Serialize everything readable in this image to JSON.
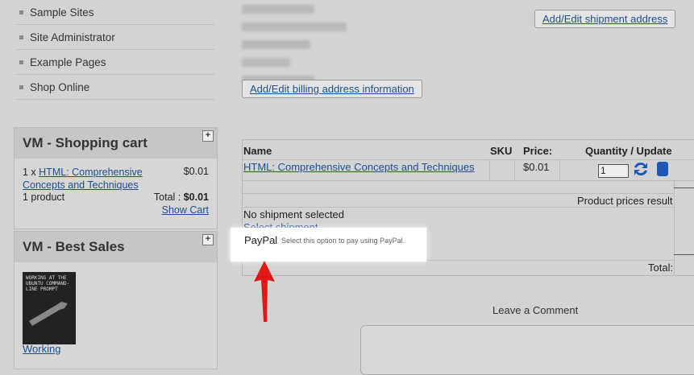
{
  "menu": {
    "items": [
      {
        "label": "Sample Sites"
      },
      {
        "label": "Site Administrator"
      },
      {
        "label": "Example Pages"
      },
      {
        "label": "Shop Online"
      }
    ]
  },
  "cart": {
    "title": "VM - Shopping cart",
    "qty_prefix": "1 x ",
    "item_link": "HTML: Comprehensive Concepts and Techniques",
    "item_price": "$0.01",
    "count": "1 product",
    "total_label": "Total : ",
    "total_value": "$0.01",
    "show_cart": "Show Cart"
  },
  "best_sales": {
    "title": "VM - Best Sales",
    "book_cover_text": "Working at the Ubuntu Command-Line Prompt",
    "book_link": "Working"
  },
  "buttons": {
    "shipment_address": "Add/Edit shipment address",
    "billing_address": "Add/Edit billing address information"
  },
  "table": {
    "headers": {
      "name": "Name",
      "sku": "SKU",
      "price": "Price:",
      "qty": "Quantity / Update"
    },
    "row": {
      "name": "HTML: Comprehensive Concepts and Techniques",
      "price": "$0.01",
      "qty": "1"
    },
    "prices_result": "Product prices result",
    "no_shipment": "No shipment selected",
    "select_shipment": "Select shipment",
    "total_label": "Total:"
  },
  "paypal": {
    "name": "PayPal",
    "desc": "Select this option to pay using PayPal."
  },
  "comment": {
    "label": "Leave a Comment"
  },
  "colors": {
    "arrow": "#e11818",
    "link": "#1f4f8f",
    "icon_blue": "#1e58b4"
  }
}
